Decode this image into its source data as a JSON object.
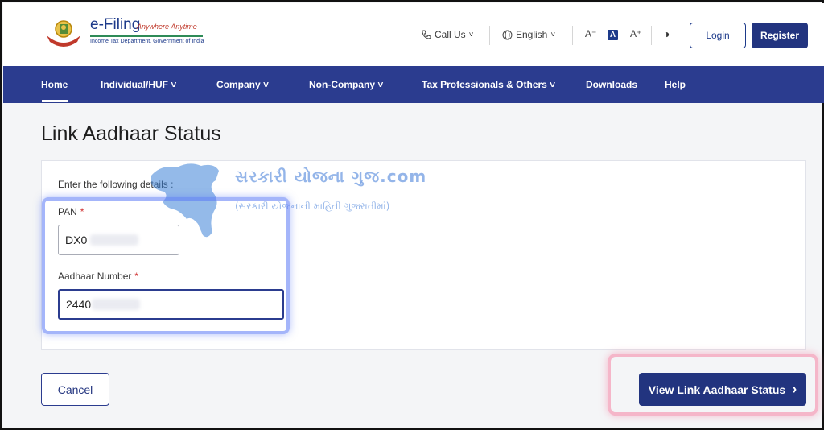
{
  "brand": {
    "title": "e-Filing",
    "tagline": "Anywhere Anytime",
    "subtitle": "Income Tax Department, Government of India"
  },
  "header": {
    "call_us": "Call Us",
    "language": "English",
    "font_decrease": "A⁻",
    "font_normal": "A",
    "font_increase": "A⁺",
    "contrast_icon": "◑",
    "login": "Login",
    "register": "Register"
  },
  "nav": {
    "items": [
      {
        "label": "Home"
      },
      {
        "label": "Individual/HUF ˅"
      },
      {
        "label": "Company ˅"
      },
      {
        "label": "Non-Company ˅"
      },
      {
        "label": "Tax Professionals & Others ˅"
      },
      {
        "label": "Downloads"
      },
      {
        "label": "Help"
      }
    ]
  },
  "page": {
    "title": "Link Aadhaar Status"
  },
  "form": {
    "instruction": "Enter the following details :",
    "pan_label": "PAN",
    "pan_value": "DX0",
    "aadhaar_label": "Aadhaar Number",
    "aadhaar_value": "2440",
    "required_mark": "*"
  },
  "watermark": {
    "title": "સરકારી યોજના ગુજ.com",
    "subtitle": "(સરકારી યોજનાની માહિતી ગુજરાતીમાં)"
  },
  "actions": {
    "cancel": "Cancel",
    "view_status": "View Link Aadhaar Status",
    "view_chevron": "›"
  },
  "colors": {
    "nav_bg": "#2b3c8f",
    "primary_button": "#22347f",
    "required": "#d03131",
    "highlight_blue": "#5a78f5",
    "highlight_pink": "#f58caa"
  }
}
